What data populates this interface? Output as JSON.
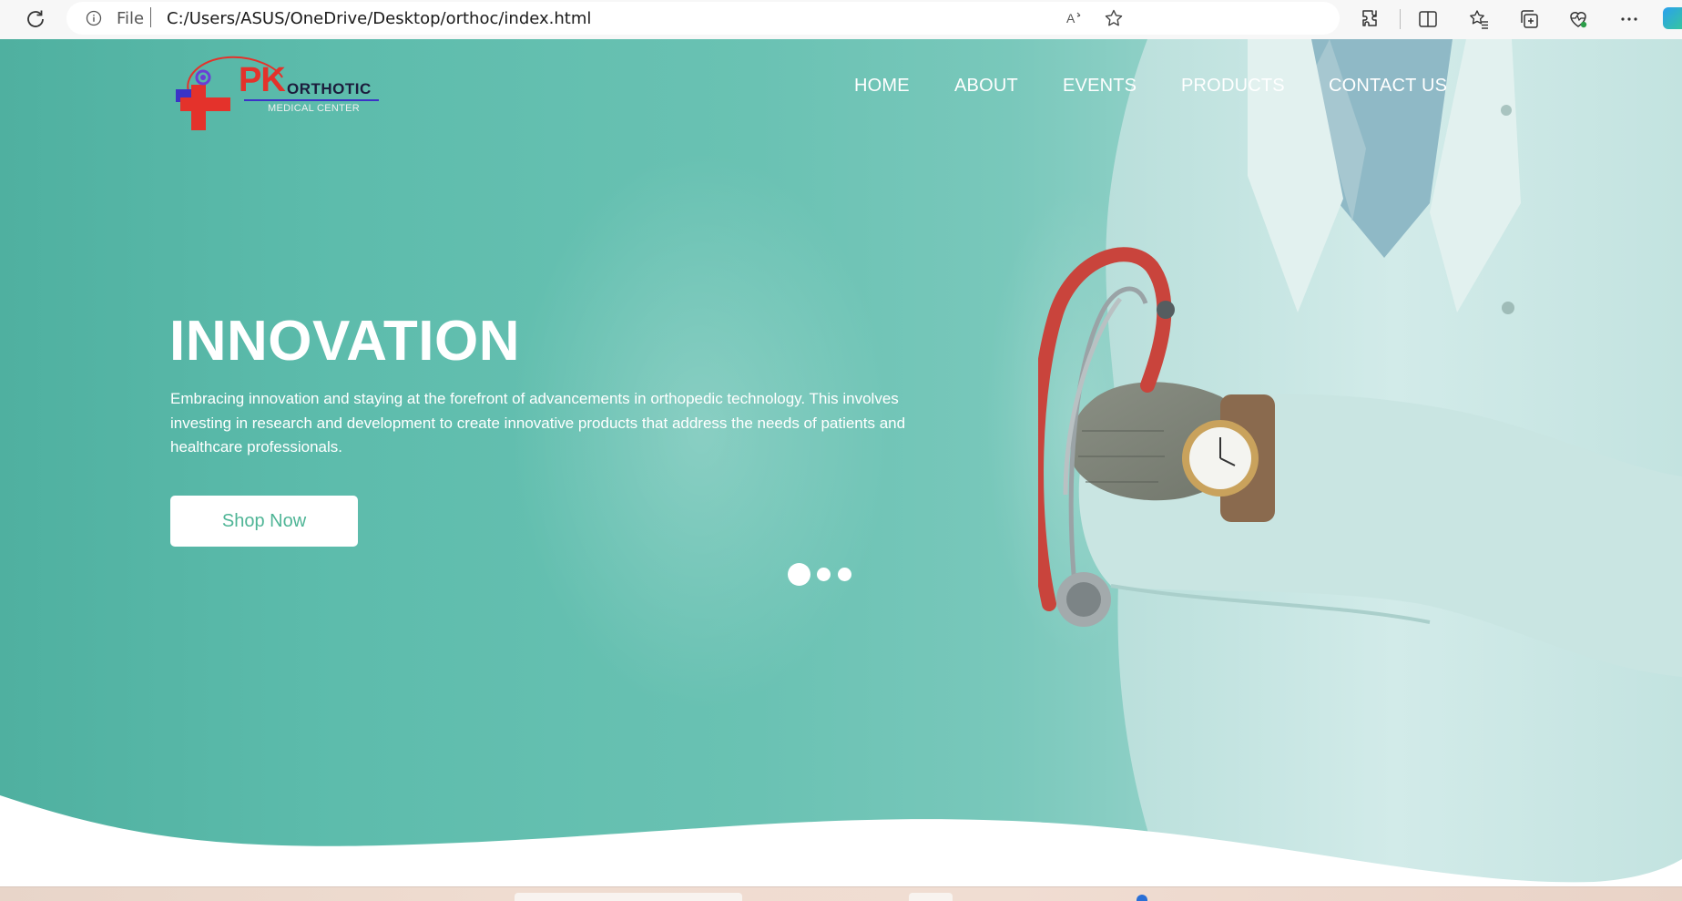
{
  "browser": {
    "scheme_label": "File",
    "url": "C:/Users/ASUS/OneDrive/Desktop/orthoc/index.html",
    "icons": [
      "reload-icon",
      "info-icon",
      "read-aloud-icon",
      "favorite-star-icon",
      "extensions-icon",
      "split-screen-icon",
      "favorites-icon",
      "collections-icon",
      "browser-essentials-icon",
      "more-icon",
      "copilot-icon"
    ]
  },
  "logo": {
    "brand": "PK",
    "name": "ORTHOTIC",
    "subtitle": "MEDICAL CENTER",
    "colors": {
      "red": "#e4322b",
      "blue": "#3b33c7",
      "purple": "#6a3fd6"
    }
  },
  "nav": {
    "items": [
      {
        "label": "HOME"
      },
      {
        "label": "ABOUT"
      },
      {
        "label": "EVENTS"
      },
      {
        "label": "PRODUCTS"
      },
      {
        "label": "CONTACT US"
      }
    ]
  },
  "hero": {
    "title": "INNOVATION",
    "description": "Embracing innovation and staying at the forefront of advancements in orthopedic technology. This involves investing in research and development to create innovative products that address the needs of patients and healthcare professionals.",
    "cta_label": "Shop Now",
    "slides_total": 3,
    "active_slide": 1
  },
  "colors": {
    "hero_teal": "#4fb0a0",
    "button_text": "#4fb596",
    "white": "#ffffff"
  }
}
